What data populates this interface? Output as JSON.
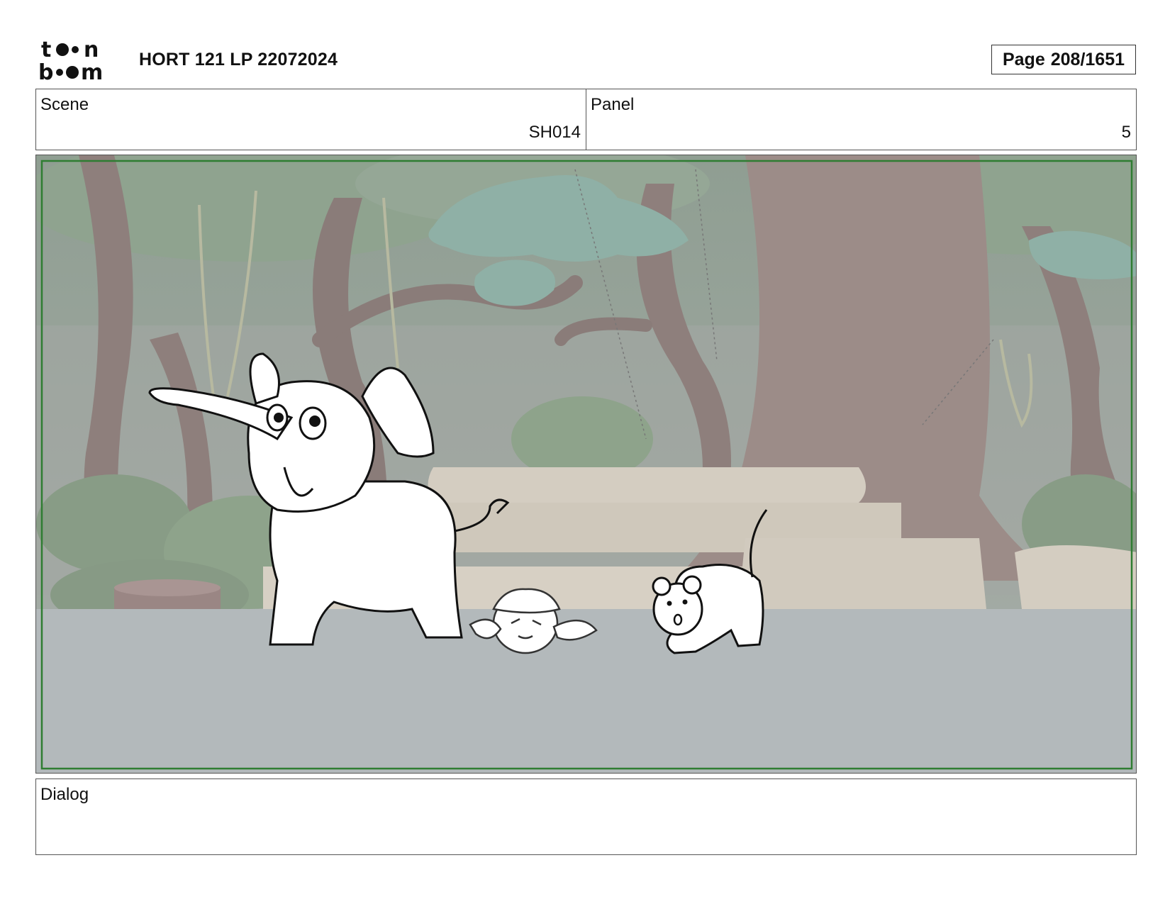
{
  "header": {
    "title": "HORT 121 LP 22072024",
    "page_label": "Page",
    "page_value": "208/1651"
  },
  "logo": {
    "icon": "toon-boom-logo",
    "text": "toon boom"
  },
  "scene": {
    "label": "Scene",
    "value": "SH014"
  },
  "panel": {
    "label": "Panel",
    "value": "5"
  },
  "image": {
    "description_icon": "storyboard-drawing"
  },
  "dialog": {
    "label": "Dialog",
    "text": ""
  },
  "colors": {
    "safe_frame": "#2f7d32",
    "border": "#555555",
    "ground": "#b3b9bb"
  }
}
